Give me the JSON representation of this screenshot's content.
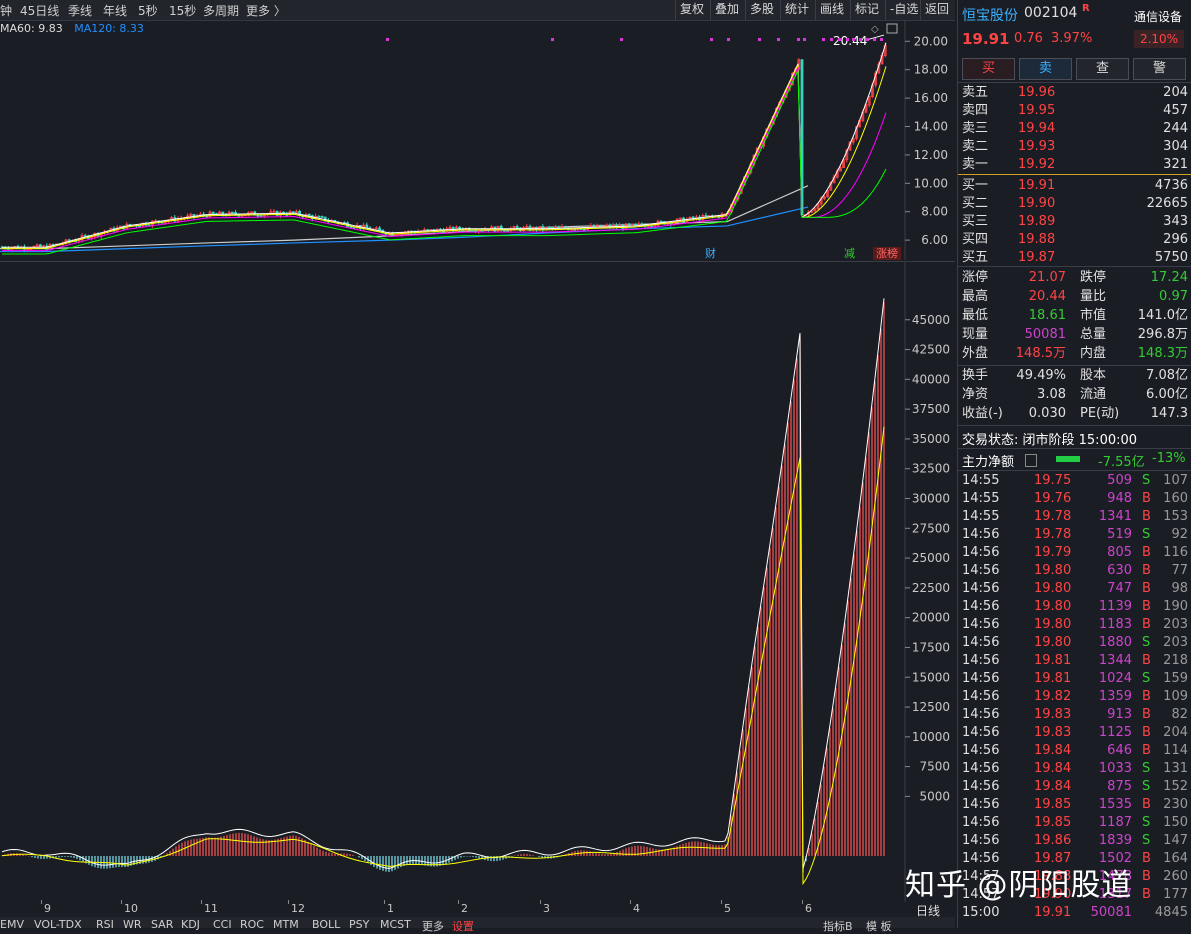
{
  "toolbar": {
    "left_items": [
      "钟",
      "45日线",
      "季线",
      "年线",
      "5秒",
      "15秒",
      "多周期",
      "更多 〉"
    ],
    "right_buttons": [
      "复权",
      "叠加",
      "多股",
      "统计",
      "画线",
      "标记",
      "-自选",
      "返回"
    ]
  },
  "ma_legend": {
    "ma60": "MA60: 9.83",
    "ma120": "MA120: 8.33"
  },
  "colors": {
    "up": "#ff4444",
    "down": "#39d2c0",
    "ma5": "#ffffff",
    "ma10": "#ffff00",
    "ma20": "#ff00ff",
    "ma30": "#00ff00",
    "ma60": "#cccccc",
    "ma120": "#1e90ff",
    "macd_up": "#ff5555",
    "macd_down": "#7fe5ef"
  },
  "price_chart": {
    "y_ticks": [
      "20.00",
      "18.00",
      "16.00",
      "14.00",
      "12.00",
      "10.00",
      "8.00",
      "6.00"
    ],
    "high_label": "20.44",
    "markers": {
      "cai": "财",
      "jian": "减",
      "zhangbang": "涨榜"
    }
  },
  "chart_data": [
    {
      "type": "line",
      "title": "",
      "xlabel": "",
      "ylabel": "",
      "ylim": [
        4.6,
        21.5
      ],
      "x": [
        "9",
        "10",
        "11",
        "12",
        "1",
        "2",
        "3",
        "4",
        "5",
        "6"
      ],
      "series": [
        {
          "name": "MA60",
          "values": [
            5.4,
            5.6,
            5.8,
            6.0,
            6.3,
            6.6,
            6.9,
            7.1,
            7.3,
            9.83
          ]
        },
        {
          "name": "MA120",
          "values": [
            5.2,
            5.4,
            5.6,
            5.8,
            6.0,
            6.2,
            6.5,
            6.8,
            7.0,
            8.33
          ]
        }
      ],
      "close_approx": [
        5.5,
        7.0,
        7.8,
        7.9,
        6.5,
        6.8,
        6.8,
        7.0,
        7.8,
        19.91
      ]
    },
    {
      "type": "bar",
      "title": "",
      "ylim": [
        0,
        47000
      ],
      "y_ticks": [
        "45000",
        "42500",
        "40000",
        "37500",
        "35000",
        "32500",
        "30000",
        "27500",
        "25000",
        "22500",
        "20000",
        "17500",
        "15000",
        "12500",
        "10000",
        "7500",
        "5000"
      ],
      "x": [
        "9",
        "10",
        "11",
        "12",
        "1",
        "2",
        "3",
        "4",
        "5",
        "6"
      ],
      "series": [
        {
          "name": "DIF",
          "values": [
            0,
            -1200,
            1800,
            1500,
            -1200,
            -300,
            0,
            600,
            1200,
            48000
          ]
        },
        {
          "name": "DEA",
          "values": [
            0,
            -900,
            1300,
            1300,
            -1000,
            -400,
            0,
            300,
            800,
            37000
          ]
        }
      ]
    }
  ],
  "x_axis_labels": [
    "9",
    "10",
    "11",
    "12",
    "1",
    "2",
    "3",
    "4",
    "5",
    "6"
  ],
  "x_axis_right": "日线",
  "bottom_tabs": [
    "EMV",
    "VOL-TDX",
    "RSI",
    "WR",
    "SAR",
    "KDJ",
    "CCI",
    "ROC",
    "MTM",
    "BOLL",
    "PSY",
    "MCST",
    "更多",
    "设置",
    "指标B",
    "模 板"
  ],
  "stock": {
    "name": "恒宝股份",
    "code": "002104",
    "flag": "R",
    "industry": "通信设备",
    "price": "19.91",
    "change": "0.76",
    "change_pct": "3.97%",
    "industry_pct": "2.10%"
  },
  "trade_buttons": [
    "买",
    "卖",
    "查",
    "警"
  ],
  "asks": [
    {
      "label": "卖五",
      "price": "19.96",
      "vol": "204"
    },
    {
      "label": "卖四",
      "price": "19.95",
      "vol": "457"
    },
    {
      "label": "卖三",
      "price": "19.94",
      "vol": "244"
    },
    {
      "label": "卖二",
      "price": "19.93",
      "vol": "304"
    },
    {
      "label": "卖一",
      "price": "19.92",
      "vol": "321"
    }
  ],
  "bids": [
    {
      "label": "买一",
      "price": "19.91",
      "vol": "4736"
    },
    {
      "label": "买二",
      "price": "19.90",
      "vol": "22665"
    },
    {
      "label": "买三",
      "price": "19.89",
      "vol": "343"
    },
    {
      "label": "买四",
      "price": "19.88",
      "vol": "296"
    },
    {
      "label": "买五",
      "price": "19.87",
      "vol": "5750"
    }
  ],
  "stats": [
    {
      "l1": "涨停",
      "v1": "21.07",
      "c1": "#ff4444",
      "l2": "跌停",
      "v2": "17.24",
      "c2": "#33cc33"
    },
    {
      "l1": "最高",
      "v1": "20.44",
      "c1": "#ff4444",
      "l2": "量比",
      "v2": "0.97",
      "c2": "#33cc33"
    },
    {
      "l1": "最低",
      "v1": "18.61",
      "c1": "#33cc33",
      "l2": "市值",
      "v2": "141.0亿",
      "c2": "#e0e0e0"
    },
    {
      "l1": "现量",
      "v1": "50081",
      "c1": "#cc44cc",
      "l2": "总量",
      "v2": "296.8万",
      "c2": "#e0e0e0"
    },
    {
      "l1": "外盘",
      "v1": "148.5万",
      "c1": "#ff4444",
      "l2": "内盘",
      "v2": "148.3万",
      "c2": "#33cc33"
    }
  ],
  "stats2": [
    {
      "l1": "换手",
      "v1": "49.49%",
      "l2": "股本",
      "v2": "7.08亿"
    },
    {
      "l1": "净资",
      "v1": "3.08",
      "l2": "流通",
      "v2": "6.00亿"
    },
    {
      "l1": "收益(-)",
      "v1": "0.030",
      "l2": "PE(动)",
      "v2": "147.3"
    }
  ],
  "trade_status": "交易状态: 闭市阶段 15:00:00",
  "main_flow": {
    "label": "主力净额",
    "value": "-7.55亿",
    "pct": "-13%"
  },
  "ticks": [
    {
      "t": "14:55",
      "p": "19.75",
      "v": "509",
      "s": "S",
      "n": "107"
    },
    {
      "t": "14:55",
      "p": "19.76",
      "v": "948",
      "s": "B",
      "n": "160"
    },
    {
      "t": "14:55",
      "p": "19.78",
      "v": "1341",
      "s": "B",
      "n": "153"
    },
    {
      "t": "14:56",
      "p": "19.78",
      "v": "519",
      "s": "S",
      "n": "92"
    },
    {
      "t": "14:56",
      "p": "19.79",
      "v": "805",
      "s": "B",
      "n": "116"
    },
    {
      "t": "14:56",
      "p": "19.80",
      "v": "630",
      "s": "B",
      "n": "77"
    },
    {
      "t": "14:56",
      "p": "19.80",
      "v": "747",
      "s": "B",
      "n": "98"
    },
    {
      "t": "14:56",
      "p": "19.80",
      "v": "1139",
      "s": "B",
      "n": "190"
    },
    {
      "t": "14:56",
      "p": "19.80",
      "v": "1183",
      "s": "B",
      "n": "203"
    },
    {
      "t": "14:56",
      "p": "19.80",
      "v": "1880",
      "s": "S",
      "n": "203"
    },
    {
      "t": "14:56",
      "p": "19.81",
      "v": "1344",
      "s": "B",
      "n": "218"
    },
    {
      "t": "14:56",
      "p": "19.81",
      "v": "1024",
      "s": "S",
      "n": "159"
    },
    {
      "t": "14:56",
      "p": "19.82",
      "v": "1359",
      "s": "B",
      "n": "109"
    },
    {
      "t": "14:56",
      "p": "19.83",
      "v": "913",
      "s": "B",
      "n": "82"
    },
    {
      "t": "14:56",
      "p": "19.83",
      "v": "1125",
      "s": "B",
      "n": "204"
    },
    {
      "t": "14:56",
      "p": "19.84",
      "v": "646",
      "s": "B",
      "n": "114"
    },
    {
      "t": "14:56",
      "p": "19.84",
      "v": "1033",
      "s": "S",
      "n": "131"
    },
    {
      "t": "14:56",
      "p": "19.84",
      "v": "875",
      "s": "S",
      "n": "152"
    },
    {
      "t": "14:56",
      "p": "19.85",
      "v": "1535",
      "s": "B",
      "n": "230"
    },
    {
      "t": "14:56",
      "p": "19.85",
      "v": "1187",
      "s": "S",
      "n": "150"
    },
    {
      "t": "14:56",
      "p": "19.86",
      "v": "1839",
      "s": "S",
      "n": "147"
    },
    {
      "t": "14:56",
      "p": "19.87",
      "v": "1502",
      "s": "B",
      "n": "164"
    },
    {
      "t": "14:57",
      "p": "19.88",
      "v": "1478",
      "s": "B",
      "n": "260"
    },
    {
      "t": "14:57",
      "p": "19.90",
      "v": "1317",
      "s": "B",
      "n": "177"
    },
    {
      "t": "15:00",
      "p": "19.91",
      "v": "50081",
      "s": "",
      "n": "4845"
    }
  ],
  "watermark": "知乎 @阴阳股道"
}
